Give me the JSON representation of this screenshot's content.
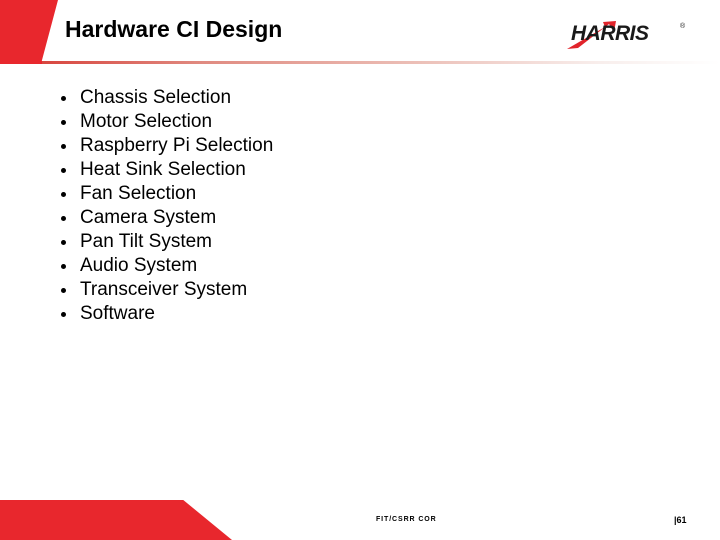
{
  "slide": {
    "title": "Hardware CI Design",
    "accent_color": "#e8272d",
    "background_color": "#ffffff",
    "text_color": "#000000"
  },
  "logo": {
    "wordmark": "HARRIS",
    "registered_mark": "®",
    "swoosh_color": "#e1242b",
    "text_color": "#1a1a1a"
  },
  "bullets": [
    {
      "label": "Chassis Selection"
    },
    {
      "label": "Motor Selection"
    },
    {
      "label": "Raspberry Pi Selection"
    },
    {
      "label": "Heat Sink Selection"
    },
    {
      "label": "Fan Selection"
    },
    {
      "label": "Camera System"
    },
    {
      "label": "Pan Tilt System"
    },
    {
      "label": "Audio System"
    },
    {
      "label": "Transceiver System"
    },
    {
      "label": "Software"
    }
  ],
  "footer": {
    "label": "FIT/CSRR COR",
    "page": "|61"
  }
}
